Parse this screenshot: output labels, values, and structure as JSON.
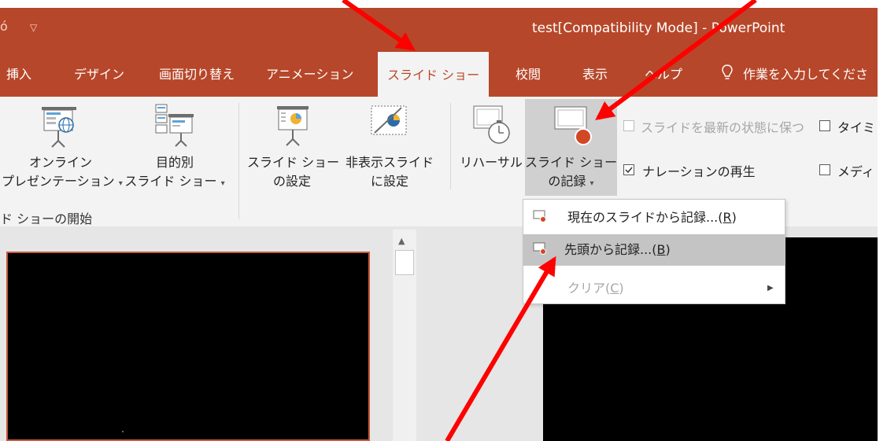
{
  "title_bar": {
    "qat_glyph": "ó",
    "qat_dropdown_icon": "triangle-down-icon",
    "window_title": "test[Compatibility Mode] - PowerPoint"
  },
  "tabs": [
    {
      "label": "挿入",
      "active": false
    },
    {
      "label": "デザイン",
      "active": false
    },
    {
      "label": "画面切り替え",
      "active": false
    },
    {
      "label": "アニメーション",
      "active": false
    },
    {
      "label": "スライド ショー",
      "active": true
    },
    {
      "label": "校閲",
      "active": false
    },
    {
      "label": "表示",
      "active": false
    },
    {
      "label": "ヘルプ",
      "active": false
    }
  ],
  "tell_me": {
    "icon": "lightbulb-icon",
    "text": "作業を入力してくださ"
  },
  "ribbon": {
    "online_presentation": {
      "line1": "オンライン",
      "line2": "プレゼンテーション",
      "icon": "online-presentation-icon"
    },
    "custom_slideshow": {
      "line1": "目的別",
      "line2": "スライド ショー",
      "icon": "custom-slideshow-icon"
    },
    "group_start_label": "ド ショーの開始",
    "setup_slideshow": {
      "line1": "スライド ショー",
      "line2": "の設定",
      "icon": "setup-slideshow-icon"
    },
    "hide_slide": {
      "line1": "非表示スライド",
      "line2": "に設定",
      "icon": "hide-slide-icon"
    },
    "rehearse": {
      "line1": "リハーサル",
      "icon": "rehearse-timings-icon"
    },
    "record": {
      "line1": "スライド ショー",
      "line2": "の記録",
      "icon": "record-slideshow-icon"
    },
    "checkboxes": [
      {
        "label": "スライドを最新の状態に保つ",
        "checked": false,
        "disabled": true
      },
      {
        "label": "タイミ",
        "checked": false,
        "disabled": false
      },
      {
        "label": "ナレーションの再生",
        "checked": true,
        "disabled": false
      },
      {
        "label": "メディ",
        "checked": false,
        "disabled": false
      }
    ]
  },
  "menu": {
    "items": [
      {
        "prefix": "現在のスライドから記録...(",
        "key": "R",
        "suffix": ")",
        "disabled": false,
        "hover": false,
        "icon": "record-from-current-icon"
      },
      {
        "prefix": "先頭から記録...(",
        "key": "B",
        "suffix": ")",
        "disabled": false,
        "hover": true,
        "icon": "record-from-beginning-icon"
      },
      {
        "prefix": "クリア(",
        "key": "C",
        "suffix": ")",
        "disabled": true,
        "hover": false,
        "icon": "",
        "submenu": true
      }
    ]
  },
  "scrollbar": {
    "up_icon": "scroll-up-arrow-icon"
  },
  "colors": {
    "ribbon_accent": "#b7472a",
    "ribbon_bg": "#f3f3f3",
    "annotation_arrow": "#ff0000",
    "record_dot": "#d24726",
    "menu_hover": "#c4c4c4"
  }
}
